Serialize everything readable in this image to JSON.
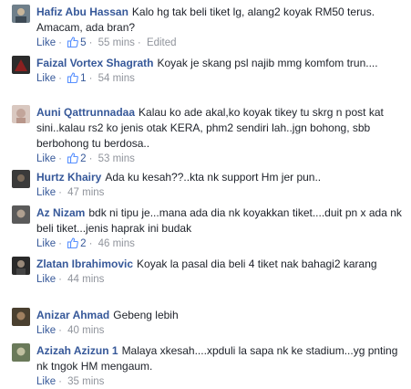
{
  "comments": [
    {
      "author": "Hafiz Abu Hassan",
      "text": "Kalo hg tak beli tiket lg, alang2 koyak RM50 terus. Amacam, ada bran?",
      "like_label": "Like",
      "reaction_count": "5",
      "time": "55 mins",
      "edited": "Edited",
      "avatar_colors": [
        "#6f7f8a",
        "#c7b59a"
      ]
    },
    {
      "author": "Faizal Vortex Shagrath",
      "text": "Koyak je skang psl najib mmg komfom trun....",
      "like_label": "Like",
      "reaction_count": "1",
      "time": "54 mins",
      "avatar_colors": [
        "#2b2b2b",
        "#8a2020"
      ]
    },
    {
      "author": "Auni Qattrunnadaa",
      "text": "Kalau ko ade akal,ko koyak tikey tu skrg n post kat sini..kalau rs2 ko jenis otak KERA, phm2 sendiri lah..jgn bohong, sbb berbohong tu berdosa..",
      "like_label": "Like",
      "reaction_count": "2",
      "time": "53 mins",
      "avatar_colors": [
        "#d9c8c0",
        "#c2a59a"
      ]
    },
    {
      "author": "Hurtz Khairy",
      "text": "Ada ku kesah??..kta nk support Hm jer pun..",
      "like_label": "Like",
      "time": "47 mins",
      "avatar_colors": [
        "#3a3a3a",
        "#7a6a5a"
      ]
    },
    {
      "author": "Az Nizam",
      "text": "bdk ni tipu je...mana ada dia nk koyakkan tiket....duit pn x ada nk beli tiket...jenis haprak ini budak",
      "like_label": "Like",
      "reaction_count": "2",
      "time": "46 mins",
      "avatar_colors": [
        "#5a5a5a",
        "#b0a090"
      ]
    },
    {
      "author": "Zlatan Ibrahimovic",
      "text": "Koyak la pasal dia beli 4 tiket nak bahagi2 karang",
      "like_label": "Like",
      "time": "44 mins",
      "avatar_colors": [
        "#2a2a2a",
        "#9a8a7a"
      ]
    },
    {
      "author": "Anizar Ahmad",
      "text": "Gebeng lebih",
      "like_label": "Like",
      "time": "40 mins",
      "avatar_colors": [
        "#4a4030",
        "#a08060"
      ]
    },
    {
      "author": "Azizah Azizun 1",
      "text": "Malaya xkesah....xpduli la sapa nk ke stadium...yg pnting nk tngok HM mengaum.",
      "like_label": "Like",
      "time": "35 mins",
      "avatar_colors": [
        "#6a7a5a",
        "#c0c0a0"
      ]
    }
  ],
  "icons": {
    "reaction": "like-thumb-icon",
    "separator": "middle-dot"
  },
  "colors": {
    "author": "#365899",
    "meta": "#90949c",
    "text": "#1d2129",
    "reaction_blue": "#5890ff"
  }
}
